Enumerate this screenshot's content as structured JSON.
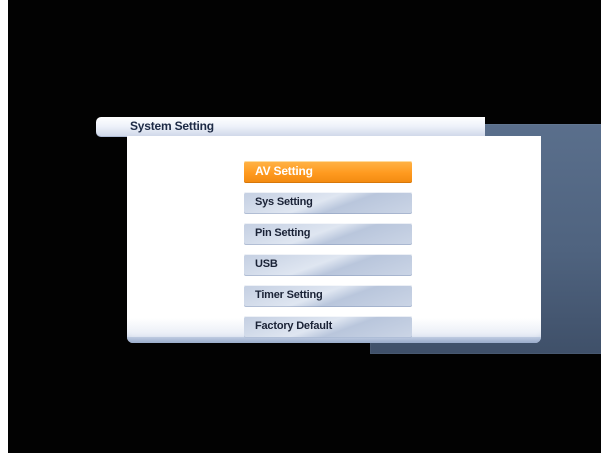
{
  "dialog": {
    "title": "System Setting"
  },
  "menu": {
    "items": [
      {
        "label": "AV  Setting",
        "selected": true
      },
      {
        "label": "Sys  Setting",
        "selected": false
      },
      {
        "label": "Pin  Setting",
        "selected": false
      },
      {
        "label": "USB",
        "selected": false
      },
      {
        "label": "Timer  Setting",
        "selected": false
      },
      {
        "label": "Factory  Default",
        "selected": false
      }
    ]
  },
  "colors": {
    "highlight": "#ff9a1f",
    "panel": "#ffffff",
    "back_panel": "#52678a",
    "screen_background": "#020202"
  }
}
